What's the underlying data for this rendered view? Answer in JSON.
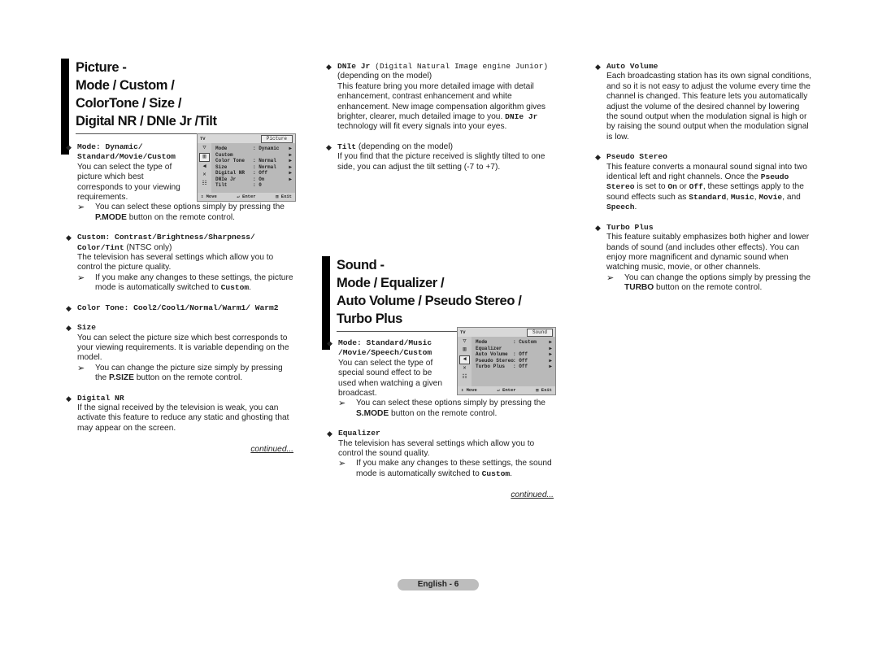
{
  "picture_section": {
    "heading_lines": [
      "Picture -",
      "Mode / Custom /",
      "ColorTone / Size /",
      "Digital NR / DNIe Jr /Tilt"
    ],
    "mode": {
      "title_a": "Mode: Dynamic/",
      "title_b": "Standard/Movie/Custom",
      "body": "You can select the type of picture which best corresponds to your viewing requirements.",
      "note_pre": "You can select these options simply by pressing the ",
      "note_key": "P.MODE",
      "note_post": " button on the remote control."
    },
    "osd": {
      "tv_label": "TV",
      "title": "Picture",
      "rows": [
        {
          "k": "Mode",
          "v": ": Dynamic",
          "a": "▶"
        },
        {
          "k": "Custom",
          "v": "",
          "a": "▶"
        },
        {
          "k": "Color Tone",
          "v": ": Normal",
          "a": "▶"
        },
        {
          "k": "Size",
          "v": ": Normal",
          "a": "▶"
        },
        {
          "k": "Digital NR",
          "v": ": Off",
          "a": "▶"
        },
        {
          "k": "DNIe Jr",
          "v": ": On",
          "a": "▶"
        },
        {
          "k": "Tilt",
          "v": ": 0",
          "a": ""
        }
      ],
      "move": "Move",
      "enter": "Enter",
      "exit": "Exit"
    },
    "custom": {
      "title_mono": "Custom: Contrast/Brightness/Sharpness/ Color/Tint",
      "title_suffix": " (NTSC only)",
      "body": "The television has several settings which allow you to control the picture quality.",
      "note_pre": "If you make any changes to these settings, the picture mode is automatically switched to ",
      "note_mono": "Custom",
      "note_post": "."
    },
    "color_tone": {
      "title": "Color Tone: Cool2/Cool1/Normal/Warm1/ Warm2"
    },
    "size": {
      "title": "Size",
      "body": "You can select the picture size which best corresponds to your viewing requirements. It is variable depending on the model.",
      "note_pre": "You can change the picture size simply by pressing the ",
      "note_key": "P.SIZE",
      "note_post": " button on the remote control."
    },
    "digital_nr": {
      "title": "Digital NR",
      "body": "If the signal received by the television is weak, you can activate this feature to reduce any static and ghosting that may appear on the screen."
    },
    "continued": "continued..."
  },
  "middle_column": {
    "dnie": {
      "title_mono": "DNIe Jr",
      "title_paren": " (Digital Natural Image engine Junior)",
      "sub": "(depending on the model)",
      "body_pre": "This feature bring you more detailed image with detail enhancement, contrast enhancement and white enhancement. New image compensation algorithm gives brighter, clearer, much detailed image to you. ",
      "body_mono": "DNIe Jr",
      "body_post": " technology will fit every signals into your eyes."
    },
    "tilt": {
      "title_mono": "Tilt",
      "title_suffix": " (depending on the model)",
      "body": "If you find that the picture received is slightly tilted to one side, you can adjust the tilt setting (-7 to +7)."
    }
  },
  "sound_section": {
    "heading_lines": [
      "Sound -",
      "Mode / Equalizer /",
      "Auto Volume / Pseudo Stereo /",
      "Turbo Plus"
    ],
    "mode": {
      "title_a": "Mode: Standard/Music",
      "title_b": "/Movie/Speech/Custom",
      "body": "You can select the type of special sound effect to be used when watching a given broadcast.",
      "note_pre": "You can select these options simply by pressing the ",
      "note_key": "S.MODE",
      "note_post": " button on the remote control."
    },
    "osd": {
      "tv_label": "TV",
      "title": "Sound",
      "rows": [
        {
          "k": "Mode",
          "v": ": Custom",
          "a": "▶"
        },
        {
          "k": "Equalizer",
          "v": "",
          "a": "▶"
        },
        {
          "k": "Auto Volume",
          "v": ": Off",
          "a": "▶"
        },
        {
          "k": "Pseudo Stereo",
          "v": ": Off",
          "a": "▶"
        },
        {
          "k": "Turbo Plus",
          "v": ": Off",
          "a": "▶"
        }
      ],
      "move": "Move",
      "enter": "Enter",
      "exit": "Exit"
    },
    "equalizer": {
      "title": "Equalizer",
      "body": "The television has several settings which allow you to control the sound quality.",
      "note_pre": "If you make any changes to these settings, the sound mode is automatically switched to ",
      "note_mono": "Custom",
      "note_post": "."
    },
    "continued": "continued..."
  },
  "right_column": {
    "auto_volume": {
      "title": "Auto Volume",
      "body": "Each broadcasting station has its own signal conditions, and so it is not easy to adjust the volume every time the channel is changed. This feature lets you automatically adjust the volume of the desired channel by lowering the sound output when the modulation signal is high or by raising the sound output when the modulation signal is low."
    },
    "pseudo_stereo": {
      "title": "Pseudo Stereo",
      "body_1": "This feature converts a monaural sound signal into two identical left and right channels. Once the ",
      "m1": "Pseudo Stereo",
      "body_2": " is set to ",
      "m2": "On",
      "body_3": " or ",
      "m3": "Off",
      "body_4": ", these settings apply to the sound effects such as ",
      "m4": "Standard",
      "sep1": ", ",
      "m5": "Music",
      "sep2": ", ",
      "m6": "Movie",
      "sep3": ", and ",
      "m7": "Speech",
      "end": "."
    },
    "turbo_plus": {
      "title": "Turbo Plus",
      "body": "This feature suitably emphasizes both higher and lower bands of sound (and includes other effects). You can enjoy more magnificent and dynamic sound when watching music, movie, or other channels.",
      "note_pre": "You can change the options simply by pressing the ",
      "note_key": "TURBO",
      "note_post": " button on the remote control."
    }
  },
  "glyphs": {
    "bullet": "◆",
    "arrow": "➢"
  },
  "footer": {
    "page_label": "English - 6"
  }
}
